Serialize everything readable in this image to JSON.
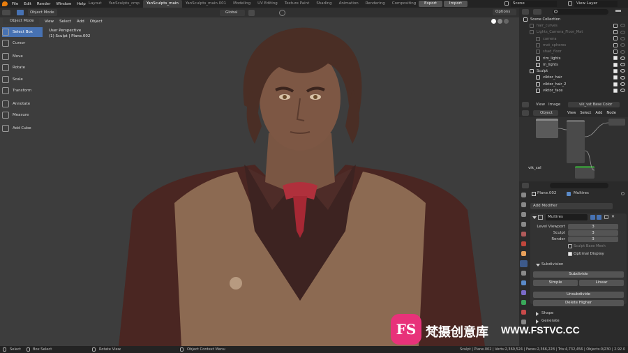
{
  "top_menu": [
    "File",
    "Edit",
    "Render",
    "Window",
    "Help"
  ],
  "workspace_tabs": [
    "Layout",
    "YanSculpts_cmp",
    "YanSculpts_main",
    "YanSculpts_main.001",
    "Modeling",
    "UV Editing",
    "Texture Paint",
    "Shading",
    "Animation",
    "Rendering",
    "Compositing",
    "Scripting"
  ],
  "active_tab_index": 2,
  "top_right": {
    "export": "Export",
    "import": "Import",
    "scene": "Scene",
    "view_layer": "View Layer"
  },
  "viewport_header": {
    "mode": "Object Mode",
    "menus": [
      "View",
      "Select",
      "Add",
      "Object"
    ],
    "transform_orientation": "Global",
    "options": "Options"
  },
  "viewport_overlay": {
    "perspective": "User Perspective",
    "object": "(1) Sculpt | Plane.002"
  },
  "toolbar": [
    "Select Box",
    "Cursor",
    "Move",
    "Rotate",
    "Scale",
    "Transform",
    "Annotate",
    "Measure",
    "Add Cube"
  ],
  "outliner": {
    "rows": [
      {
        "label": "Scene Collection",
        "indent": 0,
        "dim": false,
        "vis": false
      },
      {
        "label": "hair_curves",
        "indent": 1,
        "dim": true,
        "vis": false
      },
      {
        "label": "Lights_Camera_Floor_Mat",
        "indent": 1,
        "dim": true,
        "vis": false
      },
      {
        "label": "camera",
        "indent": 2,
        "dim": true,
        "vis": false
      },
      {
        "label": "mat_spheres",
        "indent": 2,
        "dim": true,
        "vis": false
      },
      {
        "label": "shad_floor",
        "indent": 2,
        "dim": true,
        "vis": false
      },
      {
        "label": "rim_lights",
        "indent": 2,
        "dim": false,
        "vis": true
      },
      {
        "label": "m_lights",
        "indent": 2,
        "dim": false,
        "vis": true
      },
      {
        "label": "Sculpt",
        "indent": 1,
        "dim": false,
        "vis": true
      },
      {
        "label": "viktor_hair",
        "indent": 2,
        "dim": false,
        "vis": true
      },
      {
        "label": "viktor_hair_2",
        "indent": 2,
        "dim": false,
        "vis": true
      },
      {
        "label": "viktor_face",
        "indent": 2,
        "dim": false,
        "vis": true
      }
    ]
  },
  "image_editor_header": {
    "view": "View",
    "image": "Image",
    "image_name": "vik_vst Base Color"
  },
  "node_editor_header": {
    "type": "Object",
    "menus": [
      "View",
      "Select",
      "Add",
      "Node"
    ]
  },
  "node_editor_label": "vik_col",
  "properties": {
    "object_name": "Plane.002",
    "modifier_tab": "Multires",
    "add_modifier": "Add Modifier",
    "modifier_name": "Multires",
    "fields": [
      {
        "label": "Level Viewport",
        "value": "3"
      },
      {
        "label": "Sculpt",
        "value": "3"
      },
      {
        "label": "Render",
        "value": "3"
      }
    ],
    "sculpt_base_mesh": "Sculpt Base Mesh",
    "optimal_display": "Optimal Display",
    "optimal_display_checked": true,
    "subdivision_panel": "Subdivision",
    "subdivide": "Subdivide",
    "simple": "Simple",
    "linear": "Linear",
    "unsubdivide": "Unsubdivide",
    "delete_higher": "Delete Higher",
    "shape_panel": "Shape",
    "generate_panel": "Generate"
  },
  "status_bar": {
    "left": [
      "Select",
      "Box Select",
      "Rotate View",
      "Object Context Menu"
    ],
    "right": "Sculpt | Plane.002 | Verts:2,369,524 | Faces:2,366,228 | Tris:4,732,456 | Objects:0/230 | 2.92.0"
  },
  "watermark": {
    "logo": "FS",
    "chinese": "梵摄创意库",
    "url": "WWW.FSTVC.CC"
  },
  "colors": {
    "accent": "#4772b3",
    "viewport_bg": "#3d3d3d",
    "panel_bg": "#2b2b2b",
    "header_bg": "#232323",
    "tie_red": "#b0303c",
    "watermark_pink": "#e8327a"
  }
}
